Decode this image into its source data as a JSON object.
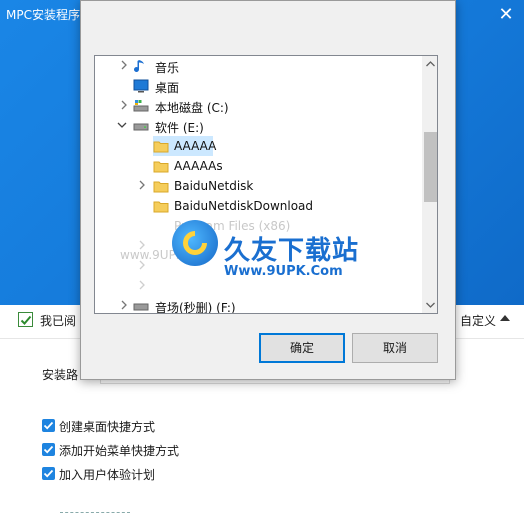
{
  "installer": {
    "title": "MPC安装程序",
    "close_glyph": "✕",
    "agree_text": "我已阅",
    "custom_label": "自定义",
    "install_dir_label": "安装路",
    "options": [
      "创建桌面快捷方式",
      "添加开始菜单快捷方式",
      "加入用户体验计划"
    ]
  },
  "folder_dialog": {
    "tree": [
      {
        "label": "音乐",
        "icon": "music-note-icon",
        "expander": "collapsed"
      },
      {
        "label": "桌面",
        "icon": "desktop-icon",
        "expander": "none"
      },
      {
        "label": "本地磁盘 (C:)",
        "icon": "drive-icon",
        "expander": "collapsed"
      },
      {
        "label": "软件 (E:)",
        "icon": "drive-icon",
        "expander": "expanded"
      },
      {
        "label": "AAAAA",
        "icon": "folder-icon",
        "expander": "none",
        "selected": true
      },
      {
        "label": "AAAAAs",
        "icon": "folder-icon",
        "expander": "none"
      },
      {
        "label": "BaiduNetdisk",
        "icon": "folder-icon",
        "expander": "collapsed"
      },
      {
        "label": "BaiduNetdiskDownload",
        "icon": "folder-icon",
        "expander": "none"
      },
      {
        "label": "Program Files (x86)",
        "icon": "folder-icon",
        "expander": "none"
      },
      {
        "label": "音场(秒删) (F:)",
        "icon": "drive-icon",
        "expander": "collapsed"
      }
    ],
    "ok_label": "确定",
    "cancel_label": "取消"
  },
  "watermark": {
    "brand_cn": "久友下载站",
    "url": "Www.9UPK.Com",
    "ghost_text": "www.9UPK.com"
  }
}
